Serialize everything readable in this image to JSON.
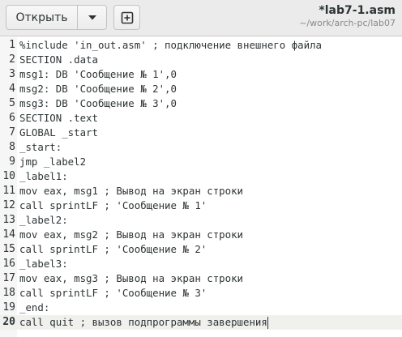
{
  "header": {
    "open_label": "Открыть",
    "menu_icon": "chevron-down-icon",
    "new_tab_icon": "new-document-icon",
    "title": "*lab7-1.asm",
    "path": "~/work/arch-pc/lab07"
  },
  "editor": {
    "current_line": 20,
    "lines": [
      {
        "n": "1",
        "text": "%include 'in_out.asm' ; подключение внешнего файла"
      },
      {
        "n": "2",
        "text": "SECTION .data"
      },
      {
        "n": "3",
        "text": "msg1: DB 'Сообщение № 1',0"
      },
      {
        "n": "4",
        "text": "msg2: DB 'Сообщение № 2',0"
      },
      {
        "n": "5",
        "text": "msg3: DB 'Сообщение № 3',0"
      },
      {
        "n": "6",
        "text": "SECTION .text"
      },
      {
        "n": "7",
        "text": "GLOBAL _start"
      },
      {
        "n": "8",
        "text": "_start:"
      },
      {
        "n": "9",
        "text": "jmp _label2"
      },
      {
        "n": "10",
        "text": "_label1:"
      },
      {
        "n": "11",
        "text": "mov eax, msg1 ; Вывод на экран строки"
      },
      {
        "n": "12",
        "text": "call sprintLF ; 'Сообщение № 1'"
      },
      {
        "n": "13",
        "text": "_label2:"
      },
      {
        "n": "14",
        "text": "mov eax, msg2 ; Вывод на экран строки"
      },
      {
        "n": "15",
        "text": "call sprintLF ; 'Сообщение № 2'"
      },
      {
        "n": "16",
        "text": "_label3:"
      },
      {
        "n": "17",
        "text": "mov eax, msg3 ; Вывод на экран строки"
      },
      {
        "n": "18",
        "text": "call sprintLF ; 'Сообщение № 3'"
      },
      {
        "n": "19",
        "text": "_end:"
      },
      {
        "n": "20",
        "text": "call quit ; вызов подпрограммы завершения"
      }
    ]
  }
}
